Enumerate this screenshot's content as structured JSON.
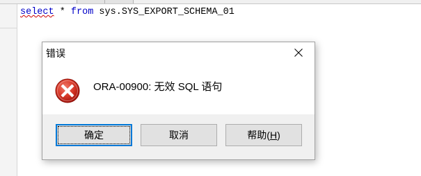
{
  "editor": {
    "sql": {
      "kw_select": "select",
      "star": " * ",
      "kw_from": "from",
      "table": " sys.SYS_EXPORT_SCHEMA_01"
    }
  },
  "dialog": {
    "title": "错误",
    "message": "ORA-00900: 无效 SQL 语句",
    "buttons": {
      "ok": "确定",
      "cancel": "取消",
      "help_prefix": "帮助(",
      "help_accel": "H",
      "help_suffix": ")"
    },
    "icons": {
      "status": "error-icon",
      "close": "close-icon"
    }
  },
  "colors": {
    "keyword": "#0000c8",
    "dialog_bg": "#f0f0f0",
    "button_bg": "#e1e1e1",
    "default_button_border": "#0078d7",
    "error_red": "#c42b1c"
  }
}
